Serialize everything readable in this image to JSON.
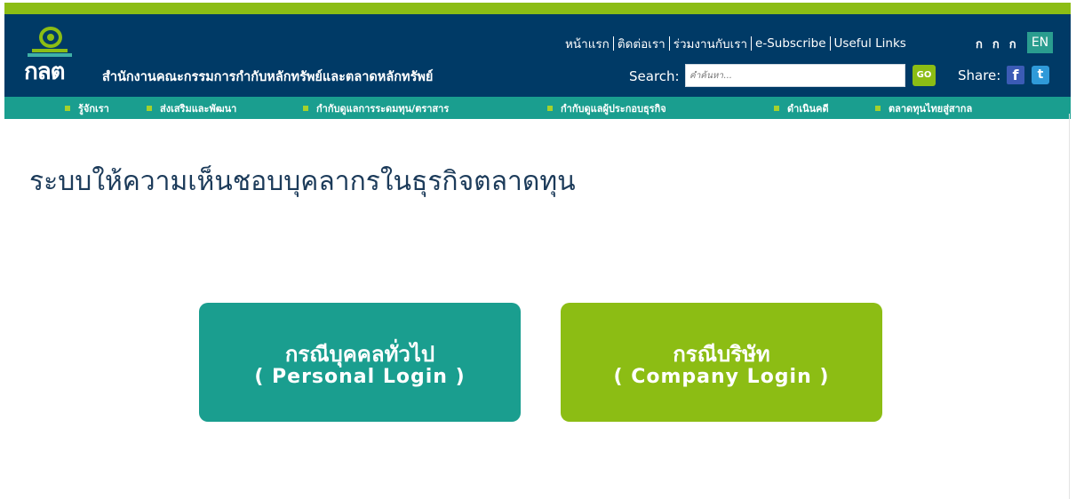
{
  "header": {
    "logo_text": "กลต",
    "org_name": "สำนักงานคณะกรรมการกำกับหลักทรัพย์และตลาดหลักทรัพย์",
    "top_links": [
      "หน้าแรก",
      "ติดต่อเรา",
      "ร่วมงานกับเรา",
      "e-Subscribe",
      "Useful Links"
    ],
    "font_size_options": [
      "ก",
      "ก",
      "ก"
    ],
    "language": "EN",
    "search": {
      "label": "Search:",
      "placeholder": "คำค้นหา...",
      "button": "GO"
    },
    "share": {
      "label": "Share:",
      "facebook": "f",
      "twitter": "t"
    }
  },
  "nav": {
    "items": [
      "รู้จักเรา",
      "ส่งเสริมและพัฒนา",
      "กำกับดูแลการระดมทุน/ตราสาร",
      "กำกับดูแลผู้ประกอบธุรกิจ",
      "ดำเนินคดี",
      "ตลาดทุนไทยสู่สากล"
    ]
  },
  "main": {
    "title": "ระบบให้ความเห็นชอบบุคลากรในธุรกิจตลาดทุน",
    "personal": {
      "line1": "กรณีบุคคลทั่วไป",
      "line2": "( Personal Login )"
    },
    "company": {
      "line1": "กรณีบริษัท",
      "line2": "( Company Login )"
    }
  },
  "colors": {
    "header_bg": "#003a66",
    "accent_green": "#8cbd14",
    "teal": "#1a9e8f",
    "title_text": "#1c3b5a"
  }
}
